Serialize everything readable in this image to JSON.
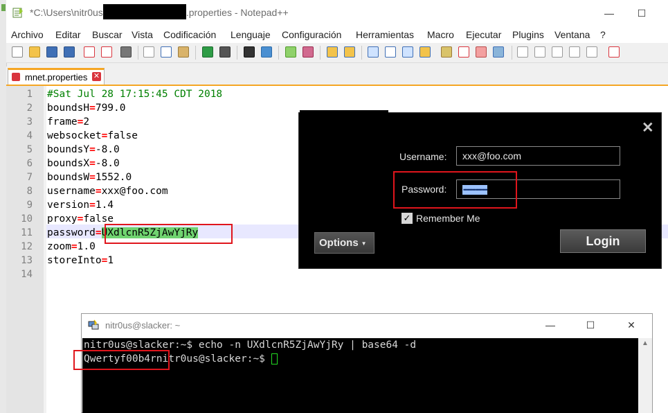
{
  "notepad": {
    "title_prefix": "*C:\\Users\\nitr0us",
    "title_suffix": ".properties - Notepad++",
    "menu": [
      "Archivo",
      "Editar",
      "Buscar",
      "Vista",
      "Codificación",
      "Lenguaje",
      "Configuración",
      "Herramientas",
      "Macro",
      "Ejecutar",
      "Plugins",
      "Ventana",
      "?"
    ],
    "tab_label": "mnet.properties",
    "line_numbers": [
      "1",
      "2",
      "3",
      "4",
      "5",
      "6",
      "7",
      "8",
      "9",
      "10",
      "11",
      "12",
      "13",
      "14"
    ],
    "lines": {
      "comment": "#Sat Jul 28 17:15:45 CDT 2018",
      "l2_key": "boundsH",
      "l2_val": "799.0",
      "l3_key": "frame",
      "l3_val": "2",
      "l4_key": "websocket",
      "l4_val": "false",
      "l5_key": "boundsY",
      "l5_val": "-8.0",
      "l6_key": "boundsX",
      "l6_val": "-8.0",
      "l7_key": "boundsW",
      "l7_val": "1552.0",
      "l8_key": "username",
      "l8_val": "xxx@foo.com",
      "l9_key": "version",
      "l9_val": "1.4",
      "l10_key": "proxy",
      "l10_val": "false",
      "l11_key": "password",
      "l11_val": "UXdlcnR5ZjAwYjRy",
      "l12_key": "zoom",
      "l12_val": "1.0",
      "l13_key": "storeInto",
      "l13_val": "1",
      "equals": "="
    }
  },
  "login": {
    "username_label": "Username:",
    "username_value": "xxx@foo.com",
    "password_label": "Password:",
    "password_mask": "••••••••••••••••",
    "remember_label": "Remember Me",
    "remember_checked": true,
    "options_label": "Options",
    "login_label": "Login",
    "close_glyph": "✕"
  },
  "terminal": {
    "title": "nitr0us@slacker: ~",
    "line1": "nitr0us@slacker:~$ echo -n UXdlcnR5ZjAwYjRy | base64 -d",
    "decoded": "Qwertyf00b4r",
    "prompt": "nitr0us@slacker:~$ "
  },
  "colors": {
    "annotation_red": "#e0151c",
    "highlight_green": "#6fd36f",
    "comment_green": "#008000",
    "operator_red": "#ff0000",
    "tab_accent": "#f5a623"
  }
}
